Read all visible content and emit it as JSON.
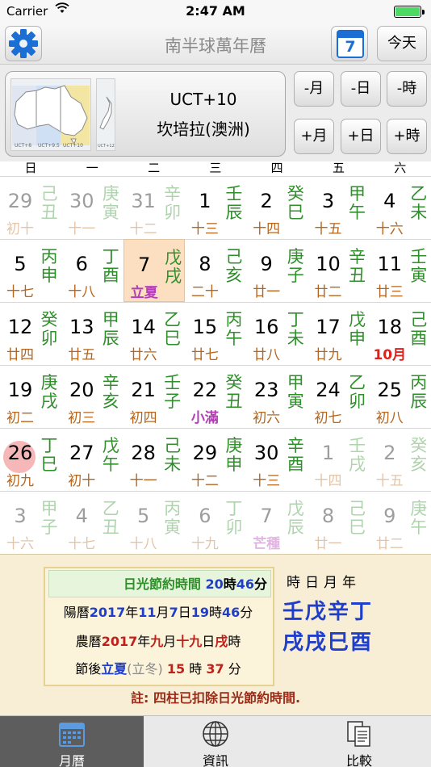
{
  "status": {
    "carrier": "Carrier",
    "time": "2:47 AM"
  },
  "nav": {
    "title": "南半球萬年曆",
    "calendar_day": "7",
    "today": "今天"
  },
  "region": {
    "code": "UCT+10",
    "city": "坎培拉(澳洲)",
    "map_labels": [
      "UCT+8",
      "UCT+9.5",
      "UCT+10",
      "UCT+12"
    ],
    "buttons": [
      "-月",
      "-日",
      "-時",
      "+月",
      "+日",
      "+時"
    ]
  },
  "weekdays": [
    "日",
    "一",
    "二",
    "三",
    "四",
    "五",
    "六"
  ],
  "days": [
    {
      "n": "29",
      "g1": "己",
      "g2": "丑",
      "l": "初十",
      "other": true
    },
    {
      "n": "30",
      "g1": "庚",
      "g2": "寅",
      "l": "十一",
      "other": true
    },
    {
      "n": "31",
      "g1": "辛",
      "g2": "卯",
      "l": "十二",
      "other": true
    },
    {
      "n": "1",
      "g1": "壬",
      "g2": "辰",
      "l": "十三"
    },
    {
      "n": "2",
      "g1": "癸",
      "g2": "巳",
      "l": "十四"
    },
    {
      "n": "3",
      "g1": "甲",
      "g2": "午",
      "l": "十五"
    },
    {
      "n": "4",
      "g1": "乙",
      "g2": "未",
      "l": "十六"
    },
    {
      "n": "5",
      "g1": "丙",
      "g2": "申",
      "l": "十七"
    },
    {
      "n": "6",
      "g1": "丁",
      "g2": "酉",
      "l": "十八"
    },
    {
      "n": "7",
      "g1": "戊",
      "g2": "戌",
      "l": "立夏",
      "term": true,
      "hl": true
    },
    {
      "n": "8",
      "g1": "己",
      "g2": "亥",
      "l": "二十"
    },
    {
      "n": "9",
      "g1": "庚",
      "g2": "子",
      "l": "廿一"
    },
    {
      "n": "10",
      "g1": "辛",
      "g2": "丑",
      "l": "廿二"
    },
    {
      "n": "11",
      "g1": "壬",
      "g2": "寅",
      "l": "廿三"
    },
    {
      "n": "12",
      "g1": "癸",
      "g2": "卯",
      "l": "廿四"
    },
    {
      "n": "13",
      "g1": "甲",
      "g2": "辰",
      "l": "廿五"
    },
    {
      "n": "14",
      "g1": "乙",
      "g2": "巳",
      "l": "廿六"
    },
    {
      "n": "15",
      "g1": "丙",
      "g2": "午",
      "l": "廿七"
    },
    {
      "n": "16",
      "g1": "丁",
      "g2": "未",
      "l": "廿八"
    },
    {
      "n": "17",
      "g1": "戊",
      "g2": "申",
      "l": "廿九"
    },
    {
      "n": "18",
      "g1": "己",
      "g2": "酉",
      "l": "10月",
      "month": true
    },
    {
      "n": "19",
      "g1": "庚",
      "g2": "戌",
      "l": "初二"
    },
    {
      "n": "20",
      "g1": "辛",
      "g2": "亥",
      "l": "初三"
    },
    {
      "n": "21",
      "g1": "壬",
      "g2": "子",
      "l": "初四"
    },
    {
      "n": "22",
      "g1": "癸",
      "g2": "丑",
      "l": "小滿",
      "term": true
    },
    {
      "n": "23",
      "g1": "甲",
      "g2": "寅",
      "l": "初六"
    },
    {
      "n": "24",
      "g1": "乙",
      "g2": "卯",
      "l": "初七"
    },
    {
      "n": "25",
      "g1": "丙",
      "g2": "辰",
      "l": "初八"
    },
    {
      "n": "26",
      "g1": "丁",
      "g2": "巳",
      "l": "初九",
      "today": true
    },
    {
      "n": "27",
      "g1": "戊",
      "g2": "午",
      "l": "初十"
    },
    {
      "n": "28",
      "g1": "己",
      "g2": "未",
      "l": "十一"
    },
    {
      "n": "29",
      "g1": "庚",
      "g2": "申",
      "l": "十二"
    },
    {
      "n": "30",
      "g1": "辛",
      "g2": "酉",
      "l": "十三"
    },
    {
      "n": "1",
      "g1": "壬",
      "g2": "戌",
      "l": "十四",
      "other": true
    },
    {
      "n": "2",
      "g1": "癸",
      "g2": "亥",
      "l": "十五",
      "other": true
    },
    {
      "n": "3",
      "g1": "甲",
      "g2": "子",
      "l": "十六",
      "other": true
    },
    {
      "n": "4",
      "g1": "乙",
      "g2": "丑",
      "l": "十七",
      "other": true
    },
    {
      "n": "5",
      "g1": "丙",
      "g2": "寅",
      "l": "十八",
      "other": true
    },
    {
      "n": "6",
      "g1": "丁",
      "g2": "卯",
      "l": "十九",
      "other": true
    },
    {
      "n": "7",
      "g1": "戊",
      "g2": "辰",
      "l": "芒種",
      "term": true,
      "other": true
    },
    {
      "n": "8",
      "g1": "己",
      "g2": "巳",
      "l": "廿一",
      "other": true
    },
    {
      "n": "9",
      "g1": "庚",
      "g2": "午",
      "l": "廿二",
      "other": true
    }
  ],
  "info": {
    "dst": {
      "label": "日光節約時間",
      "hour": "20",
      "h_unit": "時",
      "minute": "46",
      "m_unit": "分"
    },
    "solar": {
      "prefix": "陽曆",
      "year": "2017",
      "y": "年",
      "month": "11",
      "m": "月",
      "day": "7",
      "d": "日",
      "hour": "19",
      "h": "時",
      "minute": "46",
      "mi": "分"
    },
    "lunar": {
      "prefix": "農曆",
      "year": "2017",
      "y": "年",
      "month": "九",
      "m": "月",
      "day": "十九",
      "d": "日",
      "hour": "戌",
      "h": "時"
    },
    "after": {
      "prefix": "節後",
      "term": "立夏",
      "paren": "(立冬)",
      "hours": "15",
      "h": "時",
      "minutes": "37",
      "m": "分"
    },
    "pillar_head": "時日月年",
    "pillar_top": "壬戊辛丁",
    "pillar_bottom": "戌戌巳酉",
    "note": "註: 四柱已扣除日光節約時間."
  },
  "tabs": [
    {
      "label": "月曆"
    },
    {
      "label": "資訊"
    },
    {
      "label": "比較"
    }
  ],
  "colors": {
    "gz": "#2f8f2a",
    "lunar": "#b5651d",
    "term": "#b33fb5",
    "month": "#e0201b",
    "blue": "#1f3ec9",
    "red": "#c0201b"
  }
}
